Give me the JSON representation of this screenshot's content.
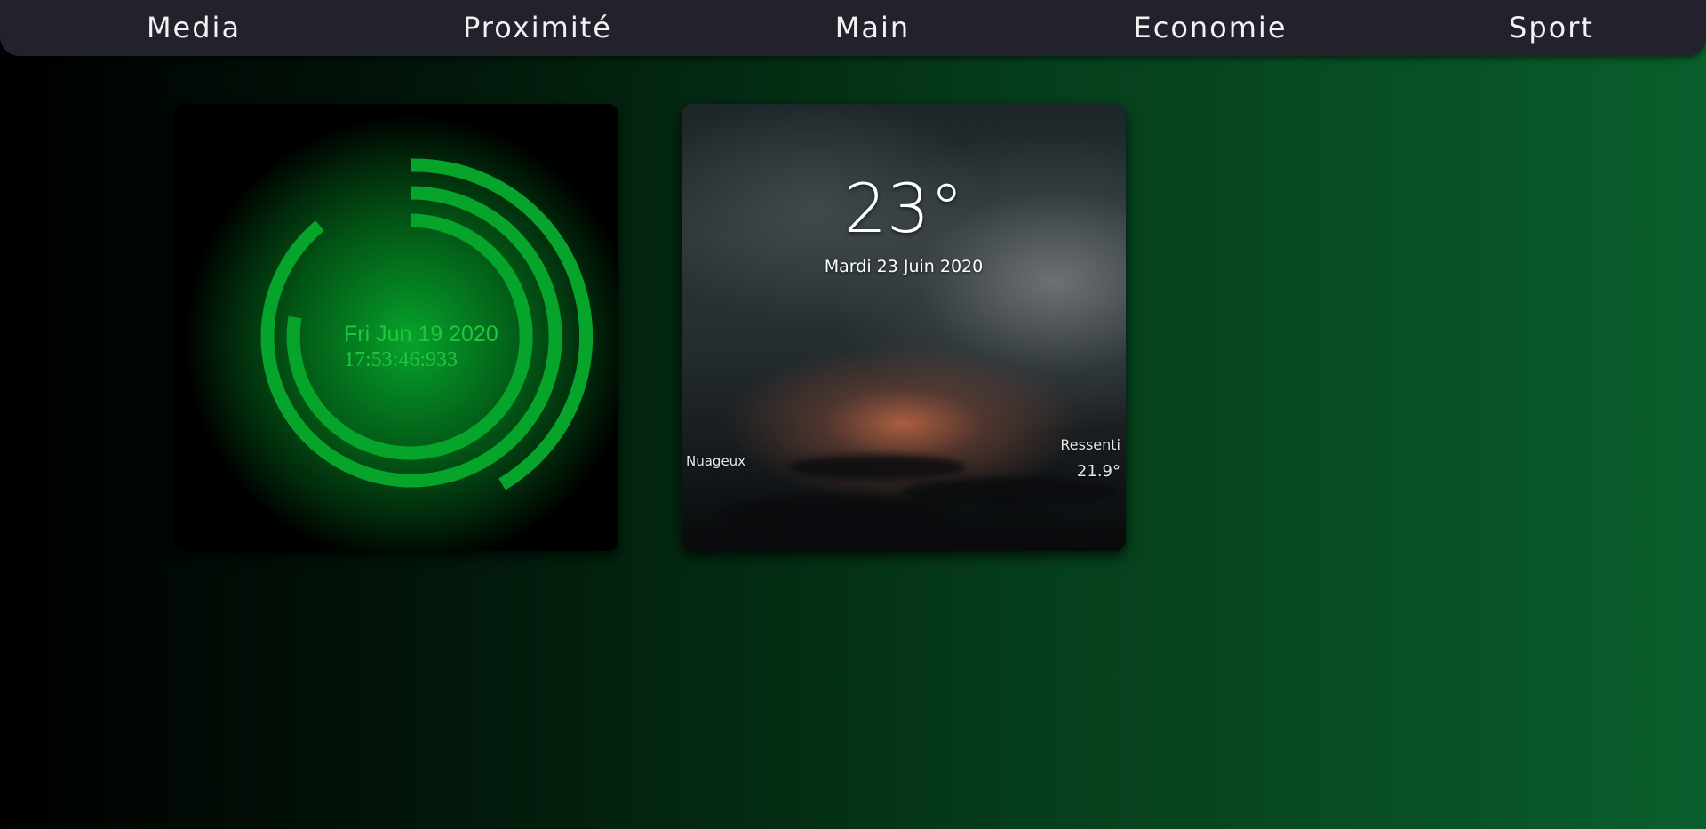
{
  "nav": {
    "items": [
      {
        "label": "Media"
      },
      {
        "label": "Proximité"
      },
      {
        "label": "Main"
      },
      {
        "label": "Economie"
      },
      {
        "label": "Sport"
      }
    ]
  },
  "clock": {
    "date": "Fri Jun 19 2020",
    "time": "17:53:46:933",
    "accent_color": "#06a42a"
  },
  "weather": {
    "temperature": "23°",
    "date": "Mardi 23 Juin 2020",
    "condition": "Nuageux",
    "feels_like_label": "Ressenti",
    "feels_like_value": "21.9°"
  }
}
